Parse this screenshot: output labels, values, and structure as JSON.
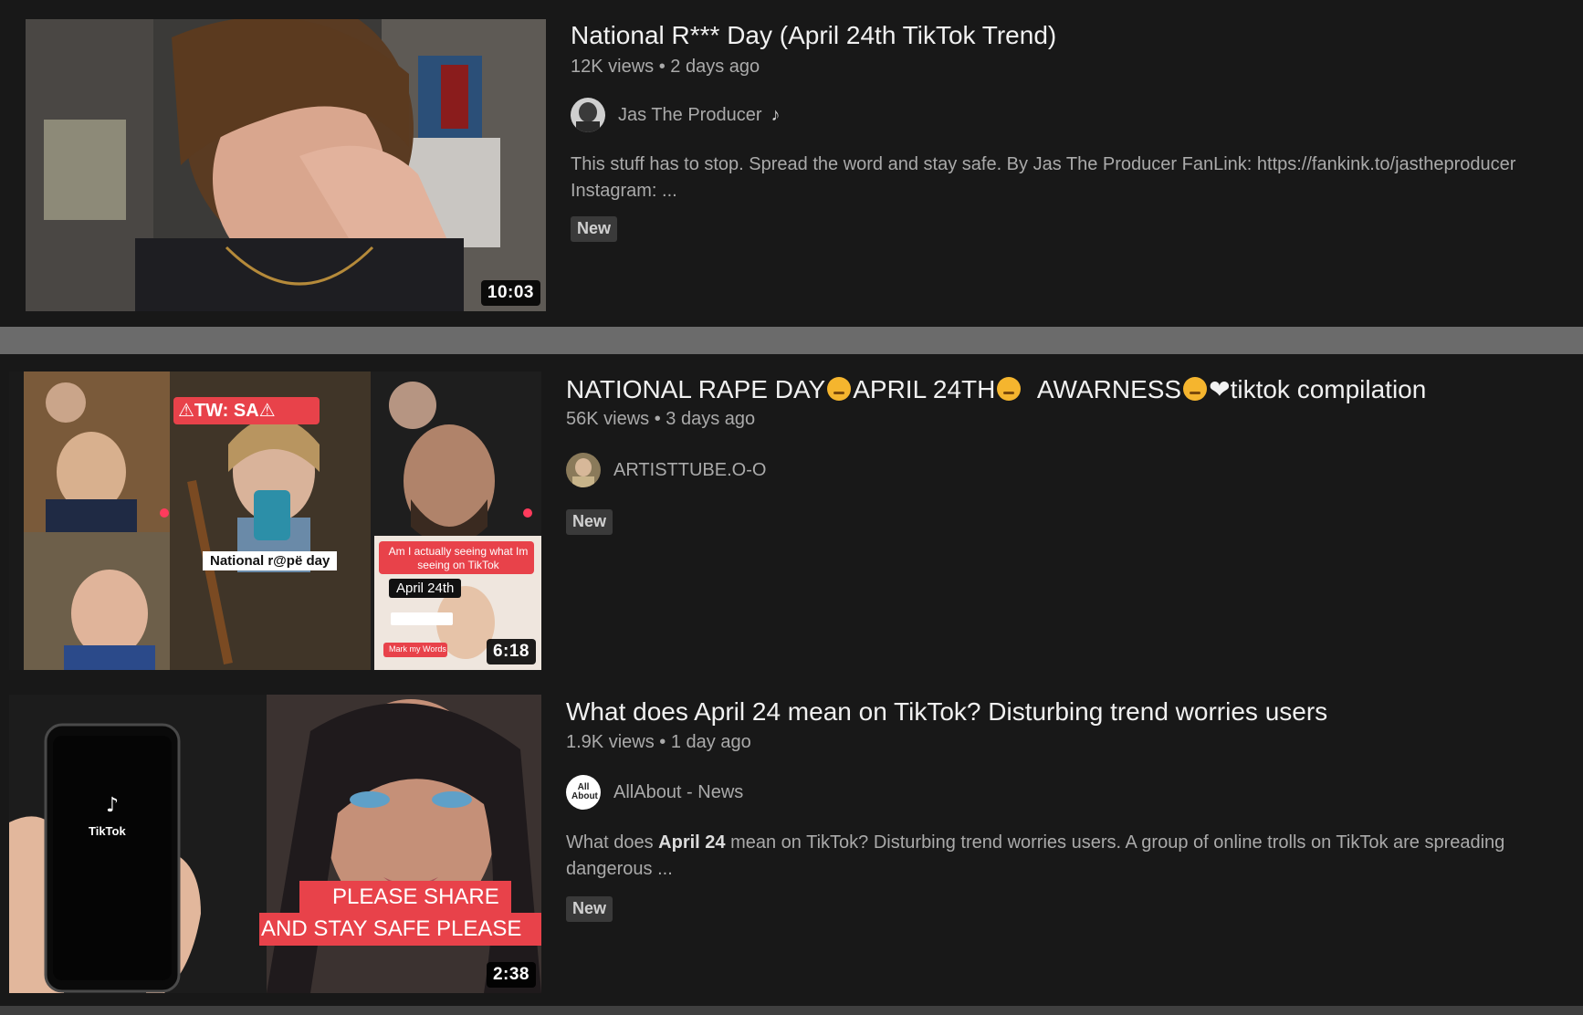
{
  "videos": [
    {
      "title": "National R*** Day (April 24th TikTok Trend)",
      "views": "12K views",
      "age": "2 days ago",
      "channel": "Jas The Producer",
      "channel_icon": "music-note-icon",
      "description": "This stuff has to stop. Spread the word and stay safe. By Jas The Producer FanLink: https://fankink.to/jastheproducer Instagram: ...",
      "badge": "New",
      "duration": "10:03"
    },
    {
      "title_parts": [
        "NATIONAL RAPE DAY",
        "APRIL 24TH",
        "AWARNESS",
        "tiktok compilation"
      ],
      "title_heart": "❤",
      "views": "56K views",
      "age": "3 days ago",
      "channel": "ARTISTTUBE.O-O",
      "badge": "New",
      "duration": "6:18",
      "thumb_text": {
        "tw": "⚠TW: SA⚠",
        "national": "National r@pë day",
        "seeing": "Am I actually seeing what Im seeing on TikTok",
        "april": "April 24th",
        "words": "Mark my Words"
      }
    },
    {
      "title": "What does April 24 mean on TikTok? Disturbing trend worries users",
      "views": "1.9K views",
      "age": "1 day ago",
      "channel": "AllAbout - News",
      "avatar_text": "All About",
      "description_pre": "What does ",
      "description_bold": "April 24",
      "description_post": " mean on TikTok? Disturbing trend worries users. A group of online trolls on TikTok are spreading dangerous ...",
      "badge": "New",
      "duration": "2:38",
      "thumb_text": {
        "tiktok": "TikTok",
        "share1": "PLEASE SHARE",
        "share2": "AND STAY SAFE PLEASE"
      }
    }
  ],
  "separator": "•",
  "colors": {
    "background": "#181818",
    "title": "#f1f1f1",
    "meta": "#aaaaaa",
    "badge_bg": "#3a3a3a",
    "tiktok_red": "#e8424a",
    "separator_bar": "#6b6b6b"
  }
}
